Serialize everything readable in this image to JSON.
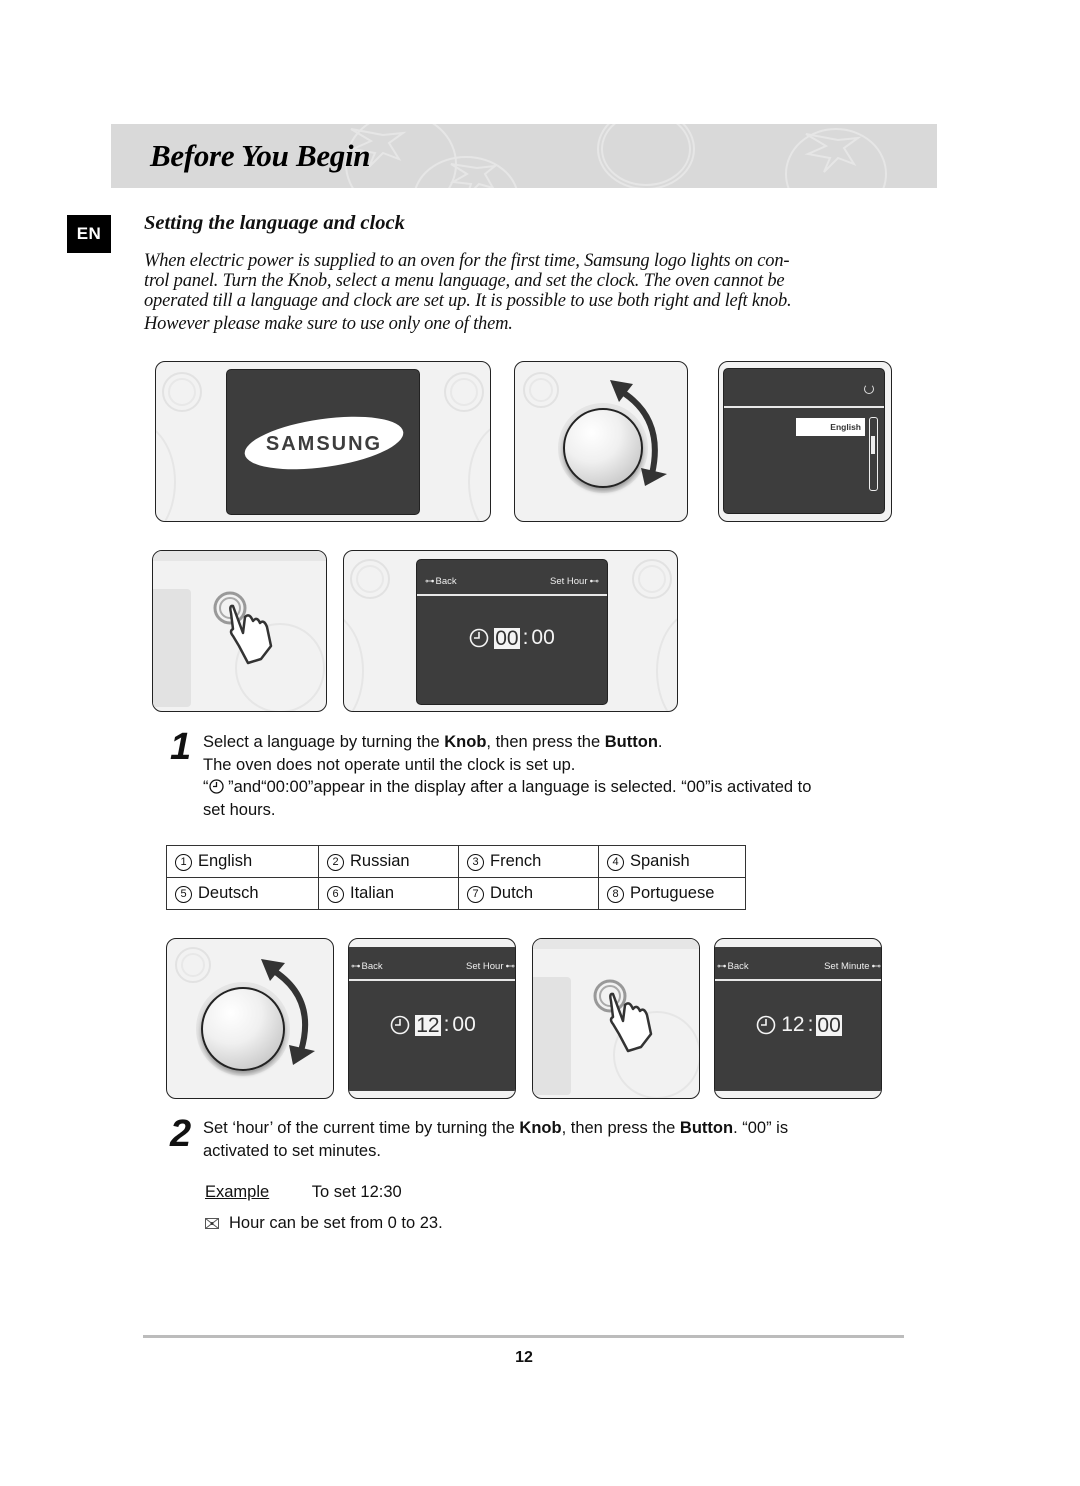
{
  "header": {
    "title": "Before You Begin"
  },
  "language_badge": "EN",
  "section": {
    "title": "Setting the language and clock",
    "intro_lines": [
      "When electric power is supplied to an oven for the first time, Samsung logo lights on con-",
      "trol panel. Turn the Knob, select a menu language, and set the clock. The oven cannot be",
      "operated till a language and clock are set up. It is possible to use both right and left knob.",
      "However please make sure to use only one of them."
    ]
  },
  "figures": {
    "logo_screen": {
      "brand": "SAMSUNG"
    },
    "language_menu": {
      "selected": "English",
      "icon": "refresh-icon"
    },
    "clock_screen_1": {
      "back_label": "Back",
      "action_label": "Set Hour",
      "hours": "00",
      "minutes": "00",
      "active": "hours"
    },
    "clock_screen_2": {
      "back_label": "Back",
      "action_label": "Set Hour",
      "hours": "12",
      "minutes": "00",
      "active": "hours"
    },
    "clock_screen_3": {
      "back_label": "Back",
      "action_label": "Set Minute",
      "hours": "12",
      "minutes": "00",
      "active": "minutes"
    },
    "colon": ":"
  },
  "step1": {
    "number": "1",
    "line1_pre": "Select a language by turning the ",
    "line1_knob": "Knob",
    "line1_mid": ", then press the ",
    "line1_button": "Button",
    "line1_end": ".",
    "line2": "The oven does not operate until the clock is set up.",
    "line3_open": "“",
    "line3_rest": " ”and“00:00”appear in the display after a language is selected. “00”is activated to",
    "line4": "set hours."
  },
  "languages": [
    {
      "num": "1",
      "name": "English"
    },
    {
      "num": "2",
      "name": "Russian"
    },
    {
      "num": "3",
      "name": "French"
    },
    {
      "num": "4",
      "name": "Spanish"
    },
    {
      "num": "5",
      "name": "Deutsch"
    },
    {
      "num": "6",
      "name": "Italian"
    },
    {
      "num": "7",
      "name": "Dutch"
    },
    {
      "num": "8",
      "name": "Portuguese"
    }
  ],
  "step2": {
    "number": "2",
    "line1_pre": "Set ‘hour’ of the current time by turning the ",
    "line1_knob": "Knob",
    "line1_mid": ", then press the ",
    "line1_button": "Button",
    "line1_end": ". “00” is",
    "line2": "activated to set minutes.",
    "example_label": "Example",
    "example_text": "To set 12:30",
    "note": "Hour can be set from 0 to 23."
  },
  "footer": {
    "page_number": "12"
  }
}
